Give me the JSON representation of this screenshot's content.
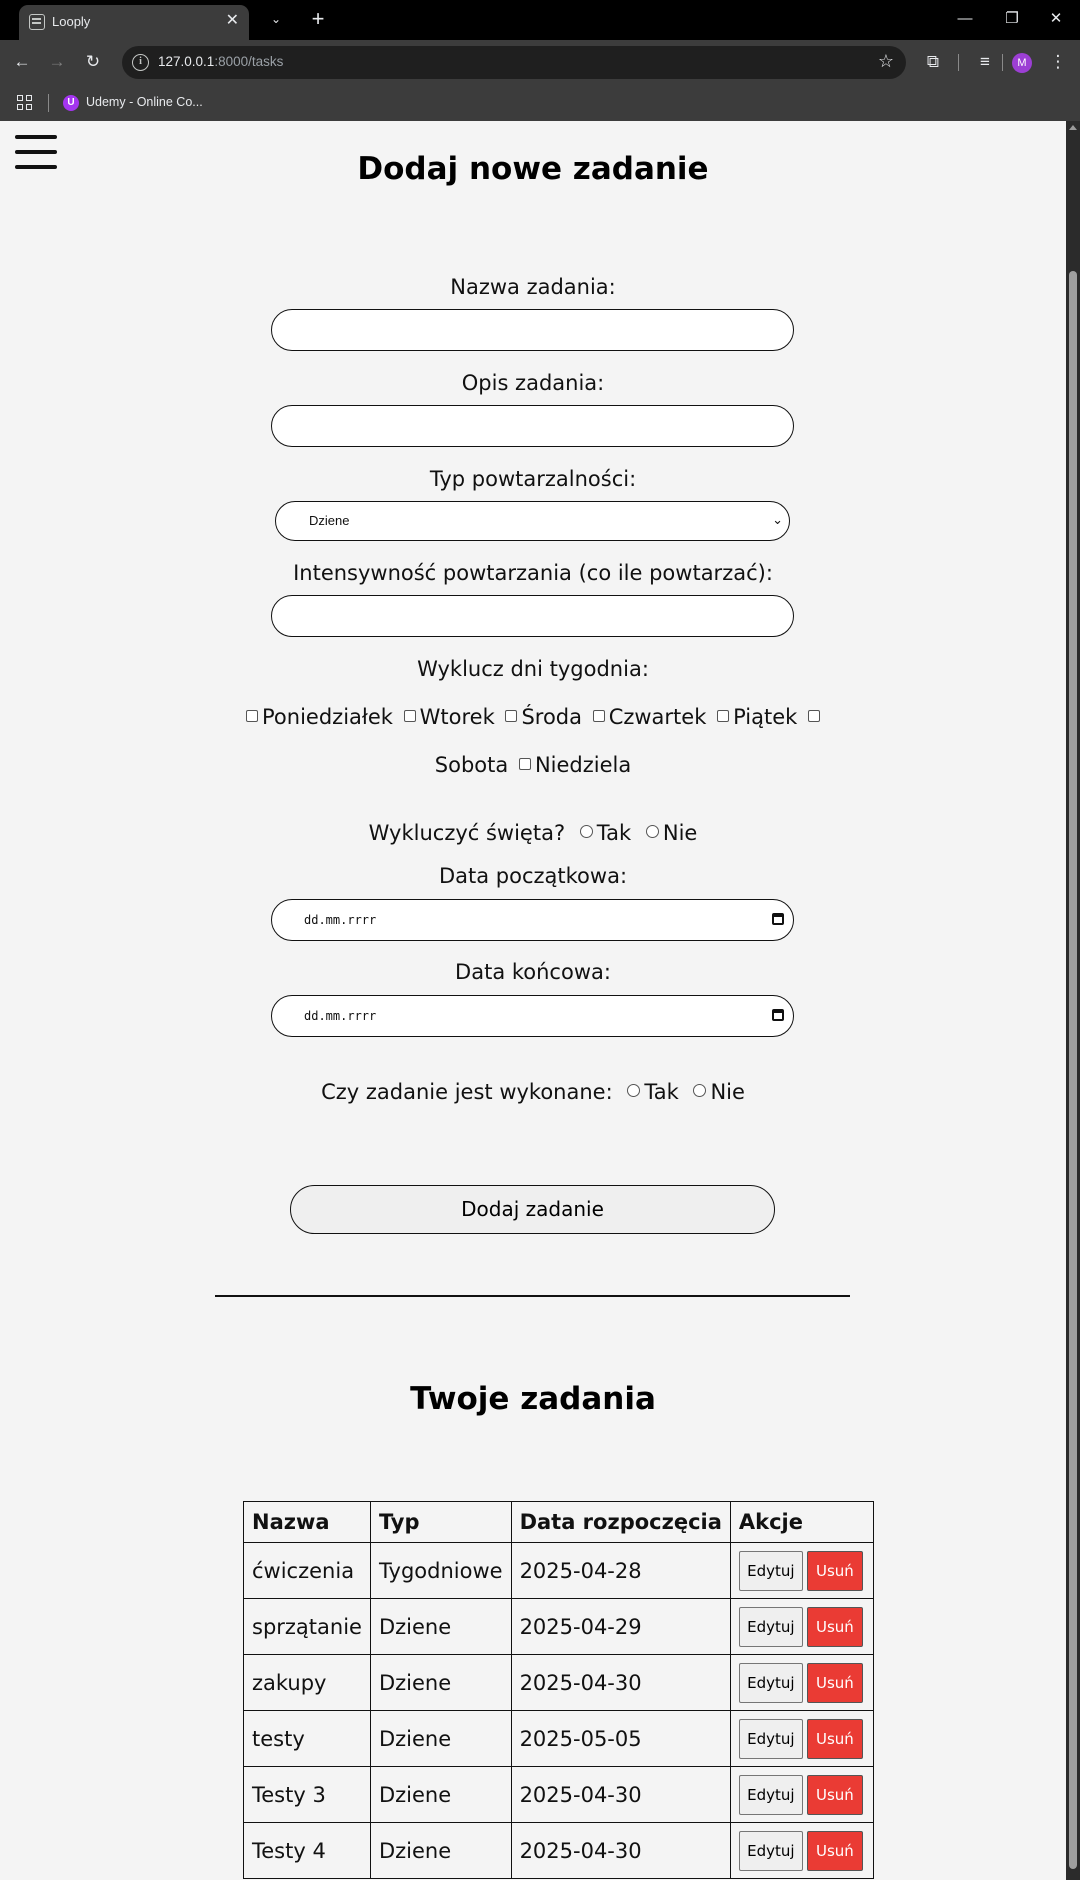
{
  "browser": {
    "tab_title": "Looply",
    "url_host": "127.0.0.1",
    "url_path": ":8000/tasks",
    "bookmark_label": "Udemy - Online Co...",
    "profile_initial": "M"
  },
  "form": {
    "title": "Dodaj nowe zadanie",
    "name_label": "Nazwa zadania:",
    "description_label": "Opis zadania:",
    "repeat_type_label": "Typ powtarzalności:",
    "repeat_type_value": "Dziene",
    "intensity_label": "Intensywność powtarzania (co ile powtarzać):",
    "exclude_days_label": "Wyklucz dni tygodnia:",
    "days": [
      "Poniedziałek",
      "Wtorek",
      "Środa",
      "Czwartek",
      "Piątek",
      "Sobota",
      "Niedziela"
    ],
    "exclude_holidays_label": "Wykluczyć święta?",
    "yes": "Tak",
    "no": "Nie",
    "start_date_label": "Data początkowa:",
    "end_date_label": "Data końcowa:",
    "date_placeholder": "dd.mm.rrrr",
    "done_label": "Czy zadanie jest wykonane:",
    "submit_label": "Dodaj zadanie"
  },
  "tasks": {
    "title": "Twoje zadania",
    "headers": [
      "Nazwa",
      "Typ",
      "Data rozpoczęcia",
      "Akcje"
    ],
    "edit_label": "Edytuj",
    "delete_label": "Usuń",
    "rows": [
      {
        "name": "ćwiczenia",
        "type": "Tygodniowe",
        "start": "2025-04-28"
      },
      {
        "name": "sprzątanie",
        "type": "Dziene",
        "start": "2025-04-29"
      },
      {
        "name": "zakupy",
        "type": "Dziene",
        "start": "2025-04-30"
      },
      {
        "name": "testy",
        "type": "Dziene",
        "start": "2025-05-05"
      },
      {
        "name": "Testy 3",
        "type": "Dziene",
        "start": "2025-04-30"
      },
      {
        "name": "Testy 4",
        "type": "Dziene",
        "start": "2025-04-30"
      }
    ]
  },
  "colors": {
    "delete_button": "#ea3b34",
    "page_background": "#f4f4f4",
    "chrome_background": "#3c3c3c"
  }
}
